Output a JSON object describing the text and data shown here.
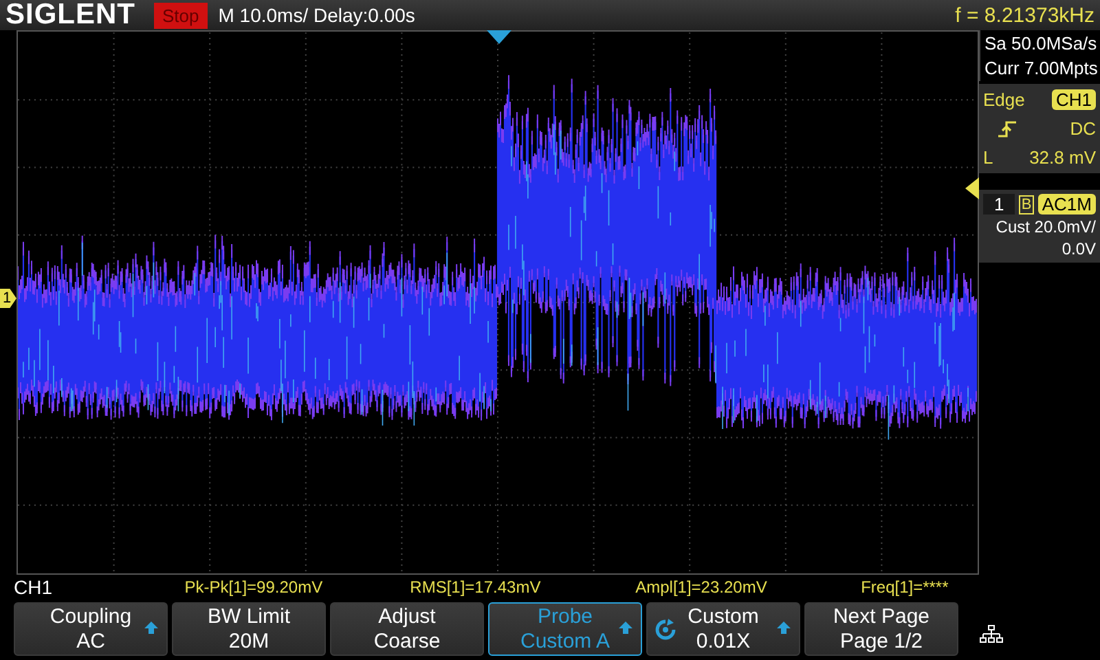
{
  "header": {
    "logo": "SIGLENT",
    "run_state": "Stop",
    "timebase": "M 10.0ms/ Delay:0.00s",
    "frequency": "f = 8.21373kHz"
  },
  "acquisition": {
    "sample_rate": "Sa 50.0MSa/s",
    "memory": "Curr 7.00Mpts"
  },
  "trigger": {
    "type": "Edge",
    "source": "CH1",
    "coupling": "DC",
    "level_label": "L",
    "level_value": "32.8 mV"
  },
  "channel": {
    "number": "1",
    "bw_mark": "B",
    "coupling": "AC1M",
    "scale": "Cust 20.0mV/",
    "offset": "0.0V"
  },
  "ch1_marker": "1",
  "channel_label": "CH1",
  "measurements": [
    "Pk-Pk[1]=99.20mV",
    "RMS[1]=17.43mV",
    "Ampl[1]=23.20mV",
    "Freq[1]=****"
  ],
  "softkeys": [
    {
      "line1": "Coupling",
      "line2": "AC",
      "arrow": true,
      "rotary": false,
      "selected": false
    },
    {
      "line1": "BW Limit",
      "line2": "20M",
      "arrow": false,
      "rotary": false,
      "selected": false
    },
    {
      "line1": "Adjust",
      "line2": "Coarse",
      "arrow": false,
      "rotary": false,
      "selected": false
    },
    {
      "line1": "Probe",
      "line2": "Custom A",
      "arrow": true,
      "rotary": false,
      "selected": true
    },
    {
      "line1": "Custom",
      "line2": "0.01X",
      "arrow": true,
      "rotary": true,
      "selected": false
    },
    {
      "line1": "Next Page",
      "line2": "Page 1/2",
      "arrow": false,
      "rotary": false,
      "selected": false
    }
  ]
}
